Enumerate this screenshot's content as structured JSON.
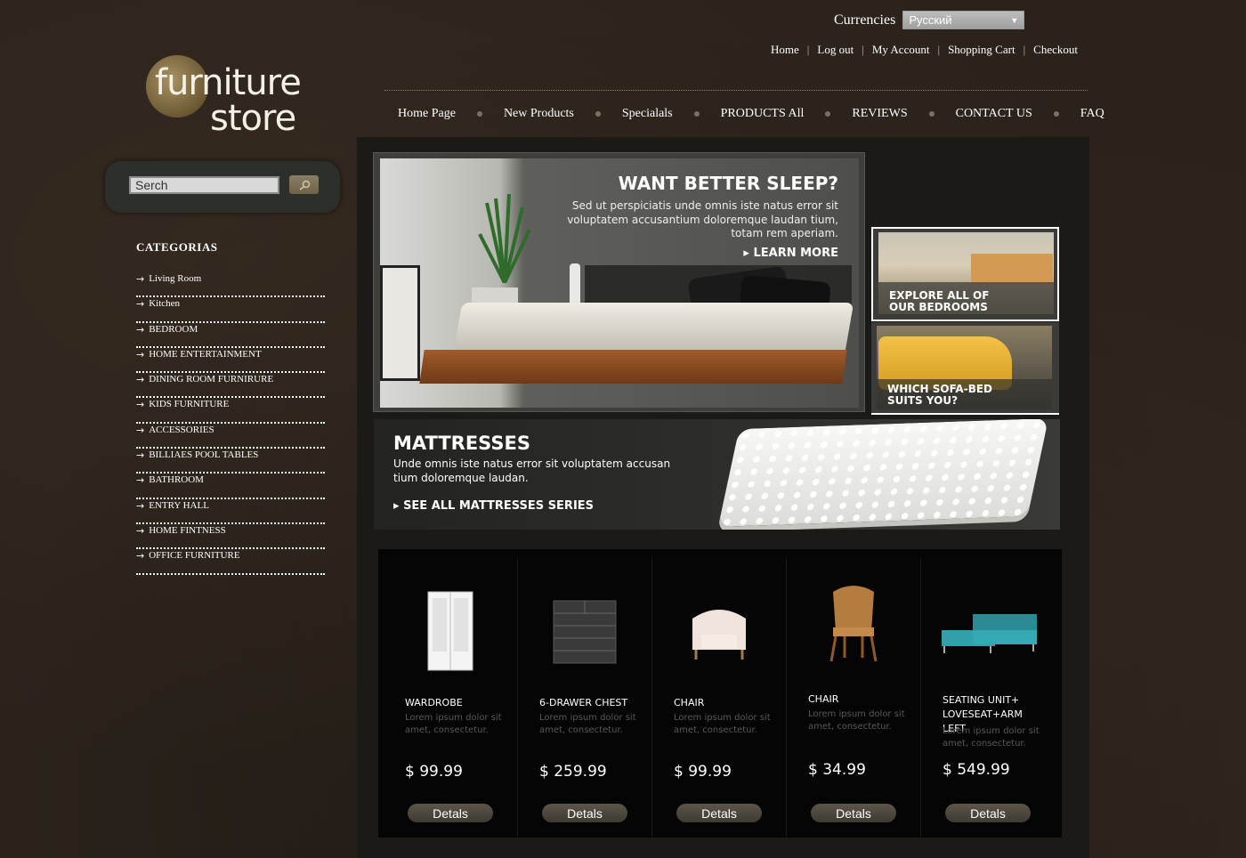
{
  "header": {
    "currencies_label": "Currencies",
    "currency_selected": "Русский",
    "top_links": [
      "Home",
      "Log out",
      "My Account",
      "Shopping Cart",
      "Checkout"
    ],
    "logo": {
      "line1": "furniture",
      "line2": "store"
    },
    "nav": [
      "Home Page",
      "New Products",
      "Specialals",
      "PRODUCTS All",
      "REVIEWS",
      "CONTACT US",
      "FAQ"
    ]
  },
  "sidebar": {
    "search_placeholder": "Serch",
    "categories_title": "CATEGORIAS",
    "categories": [
      "Living Room",
      "Kitchen",
      "BEDROOM",
      "HOME ENTERTAINMENT",
      "DINING ROOM FURNIRURE",
      "KIDS FURNITURE",
      "ACCESSORIES",
      "BILLIAES POOL TABLES",
      "BATHROOM",
      "ENTRY HALL",
      "HOME FINTNESS",
      "OFFICE FURNITURE"
    ]
  },
  "banners": {
    "main": {
      "title": "WANT BETTER SLEEP?",
      "text": "Sed ut perspiciatis unde omnis iste natus error sit voluptatem accusantium doloremque laudan tium, totam rem aperiam.",
      "more": "LEARN MORE"
    },
    "side1": {
      "line1": "EXPLORE ALL OF",
      "line2": "OUR BEDROOMS"
    },
    "side2": {
      "line1": "WHICH SOFA-BED",
      "line2": "SUITS YOU?"
    },
    "mattress": {
      "title": "MATTRESSES",
      "text": "Unde omnis iste natus error sit voluptatem accusan tium doloremque laudan.",
      "more": "SEE ALL MATTRESSES SERIES"
    }
  },
  "products": [
    {
      "name": "WARDROBE",
      "desc": "Lorem ipsum dolor sit amet, consectetur.",
      "price": "$ 99.99",
      "button": "Detals",
      "icon": "wardrobe-icon"
    },
    {
      "name": "6-DRAWER CHEST",
      "desc": "Lorem ipsum dolor sit amet, consectetur.",
      "price": "$ 259.99",
      "button": "Detals",
      "icon": "chest-icon"
    },
    {
      "name": "CHAIR",
      "desc": "Lorem ipsum dolor sit amet, consectetur.",
      "price": "$ 99.99",
      "button": "Detals",
      "icon": "armchair-icon"
    },
    {
      "name": "CHAIR",
      "desc": "Lorem ipsum dolor sit amet, consectetur.",
      "price": "$ 34.99",
      "button": "Detals",
      "icon": "wicker-chair-icon"
    },
    {
      "name": "SEATING UNIT+ LOVESEAT+ARM LEFT",
      "desc": "Lorem ipsum dolor sit amet, consectetur.",
      "price": "$ 549.99",
      "button": "Detals",
      "icon": "sectional-sofa-icon"
    }
  ]
}
